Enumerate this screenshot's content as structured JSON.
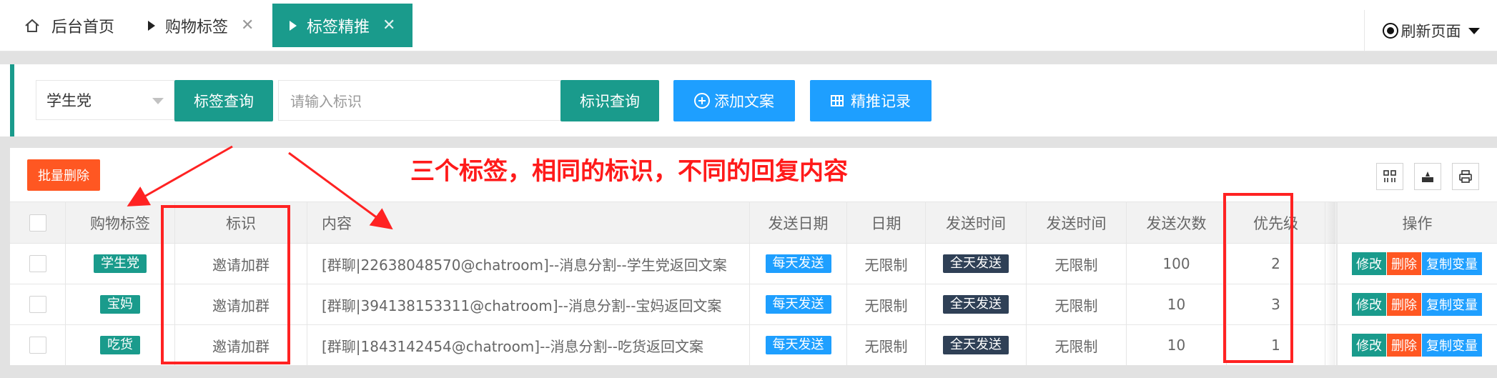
{
  "tabs": {
    "home": "后台首页",
    "shopping_tags": "购物标签",
    "tag_push": "标签精推",
    "refresh": "刷新页面"
  },
  "toolbar": {
    "select_value": "学生党",
    "tag_query": "标签查询",
    "id_placeholder": "请输入标识",
    "id_query": "标识查询",
    "add_copy": "添加文案",
    "push_records": "精推记录"
  },
  "table": {
    "batch_delete": "批量删除",
    "headers": [
      "购物标签",
      "标识",
      "内容",
      "发送日期",
      "日期",
      "发送时间",
      "发送时间",
      "发送次数",
      "优先级",
      "操作"
    ],
    "rows": [
      {
        "tag": "学生党",
        "id": "邀请加群",
        "content": "[群聊|22638048570@chatroom]--消息分割--学生党返回文案",
        "send_date": "每天发送",
        "date": "无限制",
        "send_time": "全天发送",
        "send_time2": "无限制",
        "count": "100",
        "priority": "2"
      },
      {
        "tag": "宝妈",
        "id": "邀请加群",
        "content": "[群聊|394138153311@chatroom]--消息分割--宝妈返回文案",
        "send_date": "每天发送",
        "date": "无限制",
        "send_time": "全天发送",
        "send_time2": "无限制",
        "count": "10",
        "priority": "3"
      },
      {
        "tag": "吃货",
        "id": "邀请加群",
        "content": "[群聊|1843142454@chatroom]--消息分割--吃货返回文案",
        "send_date": "每天发送",
        "date": "无限制",
        "send_time": "全天发送",
        "send_time2": "无限制",
        "count": "10",
        "priority": "1"
      }
    ],
    "ops": {
      "edit": "修改",
      "delete": "删除",
      "copy_var": "复制变量"
    }
  },
  "annotation": "三个标签，相同的标识，不同的回复内容",
  "colors": {
    "teal": "#1a9b8c",
    "blue": "#1e9fff",
    "orange": "#ff5722",
    "dark": "#2f4056",
    "annotation_red": "#ff1a1a"
  },
  "icons": [
    "home-icon",
    "play-icon",
    "close-icon",
    "radio-icon",
    "caret-down-icon",
    "plus-circle-icon",
    "table-icon",
    "columns-icon",
    "export-icon",
    "print-icon"
  ]
}
